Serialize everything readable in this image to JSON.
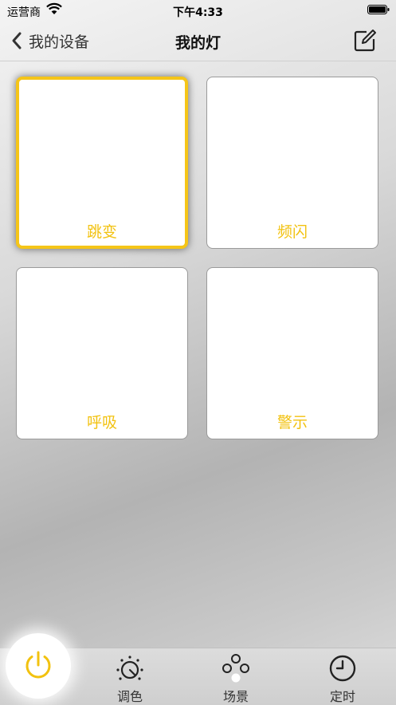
{
  "status_bar": {
    "carrier": "运营商",
    "time": "下午4:33"
  },
  "nav": {
    "back_label": "我的设备",
    "title": "我的灯"
  },
  "modes": [
    {
      "label": "跳变",
      "selected": true
    },
    {
      "label": "频闪",
      "selected": false
    },
    {
      "label": "呼吸",
      "selected": false
    },
    {
      "label": "警示",
      "selected": false
    }
  ],
  "tabs": {
    "color": "调色",
    "scene": "场景",
    "timer": "定时"
  },
  "colors": {
    "accent": "#f2c210",
    "text": "#333333"
  }
}
